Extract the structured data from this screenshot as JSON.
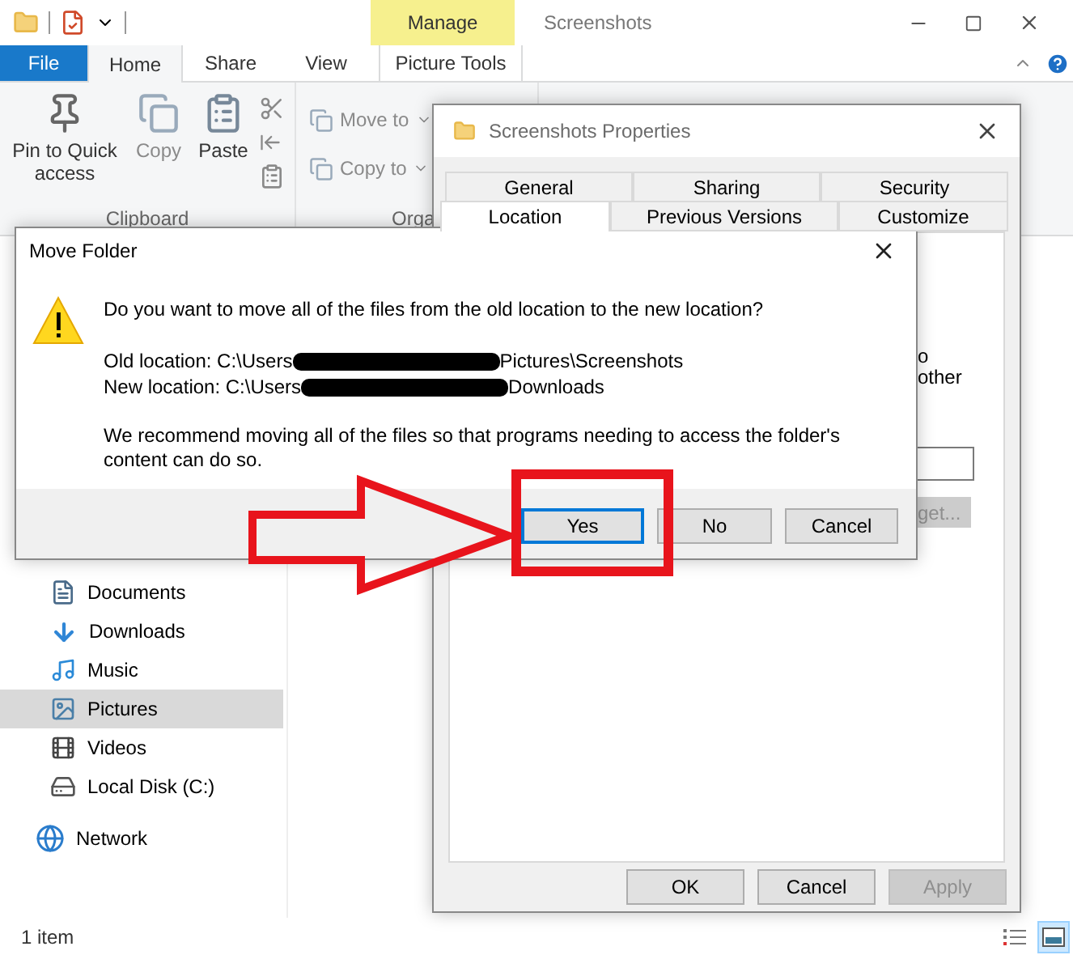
{
  "explorer": {
    "title": "Screenshots",
    "context_header": "Manage",
    "tabs": [
      {
        "label": "File",
        "kind": "file",
        "selected": false
      },
      {
        "label": "Home",
        "kind": "tab",
        "selected": true
      },
      {
        "label": "Share",
        "kind": "tab",
        "selected": false
      },
      {
        "label": "View",
        "kind": "tab",
        "selected": false
      },
      {
        "label": "Picture Tools",
        "kind": "contextual",
        "selected": false
      }
    ],
    "clipboard": {
      "label": "Clipboard",
      "buttons": [
        {
          "label": "Pin to Quick access",
          "kind": "pin",
          "disabled": false
        },
        {
          "label": "Copy",
          "kind": "copy",
          "disabled": true
        },
        {
          "label": "Paste",
          "kind": "paste",
          "disabled": false
        }
      ]
    },
    "organize": {
      "label": "Orga",
      "buttons": [
        {
          "label": "Move to",
          "disabled": true
        },
        {
          "label": "Copy to",
          "disabled": true
        }
      ]
    },
    "nav": [
      {
        "label": "Documents",
        "kind": "documents",
        "selected": false
      },
      {
        "label": "Downloads",
        "kind": "downloads",
        "selected": false
      },
      {
        "label": "Music",
        "kind": "music",
        "selected": false
      },
      {
        "label": "Pictures",
        "kind": "pictures",
        "selected": true
      },
      {
        "label": "Videos",
        "kind": "videos",
        "selected": false
      },
      {
        "label": "Local Disk (C:)",
        "kind": "disk",
        "selected": false
      },
      {
        "label": "Network",
        "kind": "network",
        "selected": false
      }
    ],
    "status": "1 item"
  },
  "properties": {
    "title": "Screenshots Properties",
    "tab_rows": [
      {
        "tabs": [
          {
            "label": "General",
            "selected": false
          },
          {
            "label": "Sharing",
            "selected": false
          },
          {
            "label": "Security",
            "selected": false
          }
        ]
      },
      {
        "tabs": [
          {
            "label": "Location",
            "selected": true
          },
          {
            "label": "Previous Versions",
            "selected": false
          },
          {
            "label": "Customize",
            "selected": false
          }
        ]
      }
    ],
    "fragments": [
      "o",
      "other"
    ],
    "target_button": {
      "label": "get...",
      "disabled": true
    },
    "buttons": [
      {
        "label": "OK",
        "disabled": false
      },
      {
        "label": "Cancel",
        "disabled": false
      },
      {
        "label": "Apply",
        "disabled": true
      }
    ]
  },
  "dialog": {
    "title": "Move Folder",
    "question": "Do you want to move all of the files from the old location to the new location?",
    "locations": [
      {
        "label": "Old location: C:\\Users",
        "redacted": true,
        "rest": "Pictures\\Screenshots"
      },
      {
        "label": "New location: C:\\Users",
        "redacted": true,
        "rest": "Downloads"
      }
    ],
    "advice": "We recommend moving all of the files so that programs needing to access the folder's content can do so.",
    "buttons": [
      {
        "label": "Yes",
        "focused": true
      },
      {
        "label": "No",
        "focused": false
      },
      {
        "label": "Cancel",
        "focused": false
      }
    ]
  }
}
